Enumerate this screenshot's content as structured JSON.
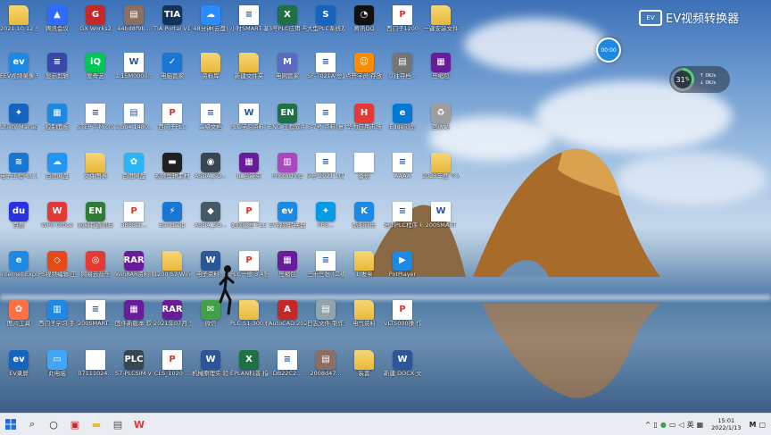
{
  "desktop": {
    "icons": [
      {
        "label": "2021.10.12 全序2020",
        "type": "folder",
        "glyph": ""
      },
      {
        "label": "腾讯会议",
        "type": "app",
        "glyph": "▲",
        "color": "#2f6bff"
      },
      {
        "label": "GX Works2",
        "type": "app",
        "glyph": "G",
        "color": "#c62828"
      },
      {
        "label": "44bd8f9b...",
        "type": "app",
        "glyph": "▤",
        "color": "#8d6e63"
      },
      {
        "label": "TIA Portal V16",
        "type": "app",
        "glyph": "TIA",
        "color": "#12325a"
      },
      {
        "label": "48分钟(云盘)",
        "type": "app",
        "glyph": "☁",
        "color": "#2a8cff"
      },
      {
        "label": "小时SMART 基础学习通讯",
        "type": "doc",
        "glyph": "≡"
      },
      {
        "label": "3号PLC应用 与 人机交互...",
        "type": "excel",
        "glyph": "X"
      },
      {
        "label": "大型PLC系统及 发",
        "type": "app",
        "glyph": "S",
        "color": "#1565c0"
      },
      {
        "label": "腾讯QQ",
        "type": "app",
        "glyph": "◔",
        "color": "#111111"
      },
      {
        "label": "西门子1200",
        "type": "pdf",
        "glyph": "P"
      },
      {
        "label": "一键安装文件",
        "type": "folder",
        "glyph": ""
      },
      {
        "label": "FEV视频录像 转换器",
        "type": "app",
        "glyph": "ev",
        "color": "#1e88e5"
      },
      {
        "label": "显示剪辑",
        "type": "app",
        "glyph": "≡",
        "color": "#3949ab"
      },
      {
        "label": "爱奇艺",
        "type": "app",
        "glyph": "iQ",
        "color": "#00c853"
      },
      {
        "label": "1.15M0000...",
        "type": "doc",
        "glyph": "W"
      },
      {
        "label": "电脑管家",
        "type": "app",
        "glyph": "✓",
        "color": "#1976d2"
      },
      {
        "label": "资料库",
        "type": "folder",
        "glyph": ""
      },
      {
        "label": "新建文件夹",
        "type": "folder",
        "glyph": ""
      },
      {
        "label": "电网管家",
        "type": "app",
        "glyph": "M",
        "color": "#5c6bc0"
      },
      {
        "label": "SF-7021A 总路(重建)",
        "type": "doc",
        "glyph": "≡"
      },
      {
        "label": "点开学员 存放频 转换器",
        "type": "app",
        "glyph": "☺",
        "color": "#fb8c00"
      },
      {
        "label": "以往存档...",
        "type": "app",
        "glyph": "▤",
        "color": "#757575"
      },
      {
        "label": "压缩包",
        "type": "app",
        "glyph": "▦",
        "color": "#6a1b9a"
      },
      {
        "label": "Utility Manager",
        "type": "app",
        "glyph": "✦",
        "color": "#1565c0"
      },
      {
        "label": "控制面板",
        "type": "app",
        "glyph": "▦",
        "color": "#1e88e5"
      },
      {
        "label": "STEP 7-MicroWIN",
        "type": "doc",
        "glyph": "≡"
      },
      {
        "label": "a.bb4 1480...",
        "type": "doc",
        "glyph": "▤"
      },
      {
        "label": "西门子PLC",
        "type": "pdf",
        "glyph": "P"
      },
      {
        "label": "二级文档",
        "type": "doc",
        "glyph": "≡"
      },
      {
        "label": "PLC学习资料 有新版",
        "type": "doc",
        "glyph": "W"
      },
      {
        "label": "ENG 工程软件",
        "type": "excel",
        "glyph": "EN"
      },
      {
        "label": "6-7号 资料(复制)",
        "type": "doc",
        "glyph": "≡"
      },
      {
        "label": "华为应用市场",
        "type": "app",
        "glyph": "H",
        "color": "#e53935"
      },
      {
        "label": "Edge浏览",
        "type": "app",
        "glyph": "e",
        "color": "#0078d4"
      },
      {
        "label": "回收站",
        "type": "app",
        "glyph": "♻",
        "color": "#9e9e9e"
      },
      {
        "label": "电子工程PLC 编程视频",
        "type": "app",
        "glyph": "≋",
        "color": "#1976d2"
      },
      {
        "label": "百度网盘",
        "type": "app",
        "glyph": "☁",
        "color": "#2196f3"
      },
      {
        "label": "文件图表",
        "type": "folder",
        "glyph": ""
      },
      {
        "label": "百度网盘",
        "type": "app",
        "glyph": "✿",
        "color": "#29b6f6"
      },
      {
        "label": "视频剪辑素材",
        "type": "app",
        "glyph": "▬",
        "color": "#212121"
      },
      {
        "label": "ASDA_SO...",
        "type": "app",
        "glyph": "◉",
        "color": "#37474f"
      },
      {
        "label": "B_台新实",
        "type": "app",
        "glyph": "▦",
        "color": "#6a1b9a"
      },
      {
        "label": "Photoshop",
        "type": "app",
        "glyph": "▥",
        "color": "#ab47bc"
      },
      {
        "label": "9号-2021 1(新版)",
        "type": "doc",
        "glyph": "≡"
      },
      {
        "label": "备份",
        "type": "doc",
        "glyph": ""
      },
      {
        "label": "AAAA",
        "type": "doc",
        "glyph": "≡"
      },
      {
        "label": "2023年度 个人材料",
        "type": "folder",
        "glyph": ""
      },
      {
        "label": "百度",
        "type": "app",
        "glyph": "du",
        "color": "#2932e1"
      },
      {
        "label": "WPS Office",
        "type": "app",
        "glyph": "W",
        "color": "#e53935"
      },
      {
        "label": "网易有道词典",
        "type": "app",
        "glyph": "EN",
        "color": "#2e7d32"
      },
      {
        "label": "380Set...",
        "type": "pdf",
        "glyph": "P"
      },
      {
        "label": "BandiZip",
        "type": "app",
        "glyph": "⚡",
        "color": "#1976d2"
      },
      {
        "label": "ASDA_SO...",
        "type": "app",
        "glyph": "◆",
        "color": "#455a64"
      },
      {
        "label": "如何建立 PLC",
        "type": "pdf",
        "glyph": "P"
      },
      {
        "label": "EV视频转换器",
        "type": "app",
        "glyph": "ev",
        "color": "#1e88e5"
      },
      {
        "label": "FPS...",
        "type": "app",
        "glyph": "✦",
        "color": "#039be5"
      },
      {
        "label": "酷狗音乐",
        "type": "app",
        "glyph": "K",
        "color": "#1e88e5"
      },
      {
        "label": "培训PLC程序 编程手...",
        "type": "doc",
        "glyph": "≡"
      },
      {
        "label": "200SMART",
        "type": "doc",
        "glyph": "W"
      },
      {
        "label": "Internet Explorer",
        "type": "app",
        "glyph": "e",
        "color": "#1e88e5"
      },
      {
        "label": "PS视频编辑 工具",
        "type": "app",
        "glyph": "◇",
        "color": "#e64a19"
      },
      {
        "label": "网易云音乐",
        "type": "app",
        "glyph": "◎",
        "color": "#e53935"
      },
      {
        "label": "WinRAR资料 压缩",
        "type": "app",
        "glyph": "RAR",
        "color": "#6a1b9a"
      },
      {
        "label": "1200 S7 WinCC...",
        "type": "folder",
        "glyph": ""
      },
      {
        "label": "电子资料...",
        "type": "word",
        "glyph": "W"
      },
      {
        "label": "PLC一般 3.4张(V1-一般)",
        "type": "pdf",
        "glyph": "P"
      },
      {
        "label": "压缩包",
        "type": "app",
        "glyph": "▦",
        "color": "#6a1b9a"
      },
      {
        "label": "三十三张 (二级)一二",
        "type": "doc",
        "glyph": "≡"
      },
      {
        "label": "1.发票",
        "type": "folder",
        "glyph": ""
      },
      {
        "label": "PotPlayer",
        "type": "app",
        "glyph": "▶",
        "color": "#1e88e5"
      },
      {
        "label": "图片工具",
        "type": "app",
        "glyph": "✿",
        "color": "#ff7043"
      },
      {
        "label": "西门子学习 手册",
        "type": "app",
        "glyph": "▥",
        "color": "#1e88e5"
      },
      {
        "label": "200SMART...",
        "type": "doc",
        "glyph": "≡"
      },
      {
        "label": "固件新版本 软件包合集",
        "type": "app",
        "glyph": "▦",
        "color": "#6a1b9a"
      },
      {
        "label": "2021年07月 分析资料",
        "type": "app",
        "glyph": "RAR",
        "color": "#6a1b9a"
      },
      {
        "label": "微信",
        "type": "app",
        "glyph": "✉",
        "color": "#43a047"
      },
      {
        "label": "PLC S1-300 作业分享",
        "type": "folder",
        "glyph": ""
      },
      {
        "label": "AutoCAD 2020 - 简",
        "type": "app",
        "glyph": "A",
        "color": "#c62828"
      },
      {
        "label": "日志文件 制作资料",
        "type": "app",
        "glyph": "▤",
        "color": "#90a4ae"
      },
      {
        "label": "电气资料",
        "type": "folder",
        "glyph": ""
      },
      {
        "label": "VLT5000操 作说明(M...",
        "type": "pdf",
        "glyph": "P"
      },
      {
        "label": "EV录屏",
        "type": "app",
        "glyph": "ev",
        "color": "#1565c0"
      },
      {
        "label": "此电脑",
        "type": "app",
        "glyph": "▭",
        "color": "#42a5f5"
      },
      {
        "label": "07111024...",
        "type": "doc",
        "glyph": ""
      },
      {
        "label": "S7-PLCSIM V16",
        "type": "app",
        "glyph": "PLC",
        "color": "#37474f"
      },
      {
        "label": "CLS_1020 ...",
        "type": "pdf",
        "glyph": "P"
      },
      {
        "label": "机械原理实 验(整理版)",
        "type": "word",
        "glyph": "W"
      },
      {
        "label": "EPLAN科普 指南",
        "type": "excel",
        "glyph": "X"
      },
      {
        "label": "DB22C2...",
        "type": "doc",
        "glyph": "≡"
      },
      {
        "label": "2008d47...",
        "type": "app",
        "glyph": "▤",
        "color": "#8d6e63"
      },
      {
        "label": "装置",
        "type": "folder",
        "glyph": ""
      },
      {
        "label": "新建 DOCX 文档",
        "type": "word",
        "glyph": "W"
      }
    ]
  },
  "overlay": {
    "ev_logo_text": "EV视频转换器",
    "ev_cam_glyph": "EV",
    "rec_button": "00:00",
    "perf_value": "31",
    "perf_unit": "%",
    "perf_percent": 31,
    "perf_line1": "0K/s",
    "perf_line2": "0K/s"
  },
  "taskbar": {
    "start_icon": "windows-icon",
    "time": "15:01",
    "date": "2022/1/13",
    "ime": "英",
    "chevron": "^"
  },
  "colors": {
    "taskbar_bg": "#e9edf2",
    "accent": "#1e88e5"
  }
}
